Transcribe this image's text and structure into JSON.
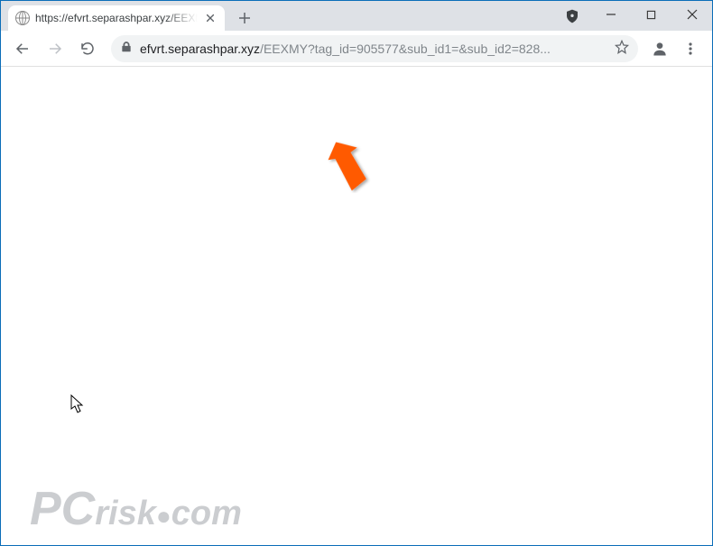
{
  "tab": {
    "title": "https://efvrt.separashpar.xyz/EEXMY"
  },
  "url": {
    "host": "efvrt.separashpar.xyz",
    "path": "/EEXMY?tag_id=905577&sub_id1=&sub_id2=828..."
  },
  "watermark": {
    "pc": "PC",
    "risk": "risk",
    "dot": "●",
    "com": "com"
  }
}
